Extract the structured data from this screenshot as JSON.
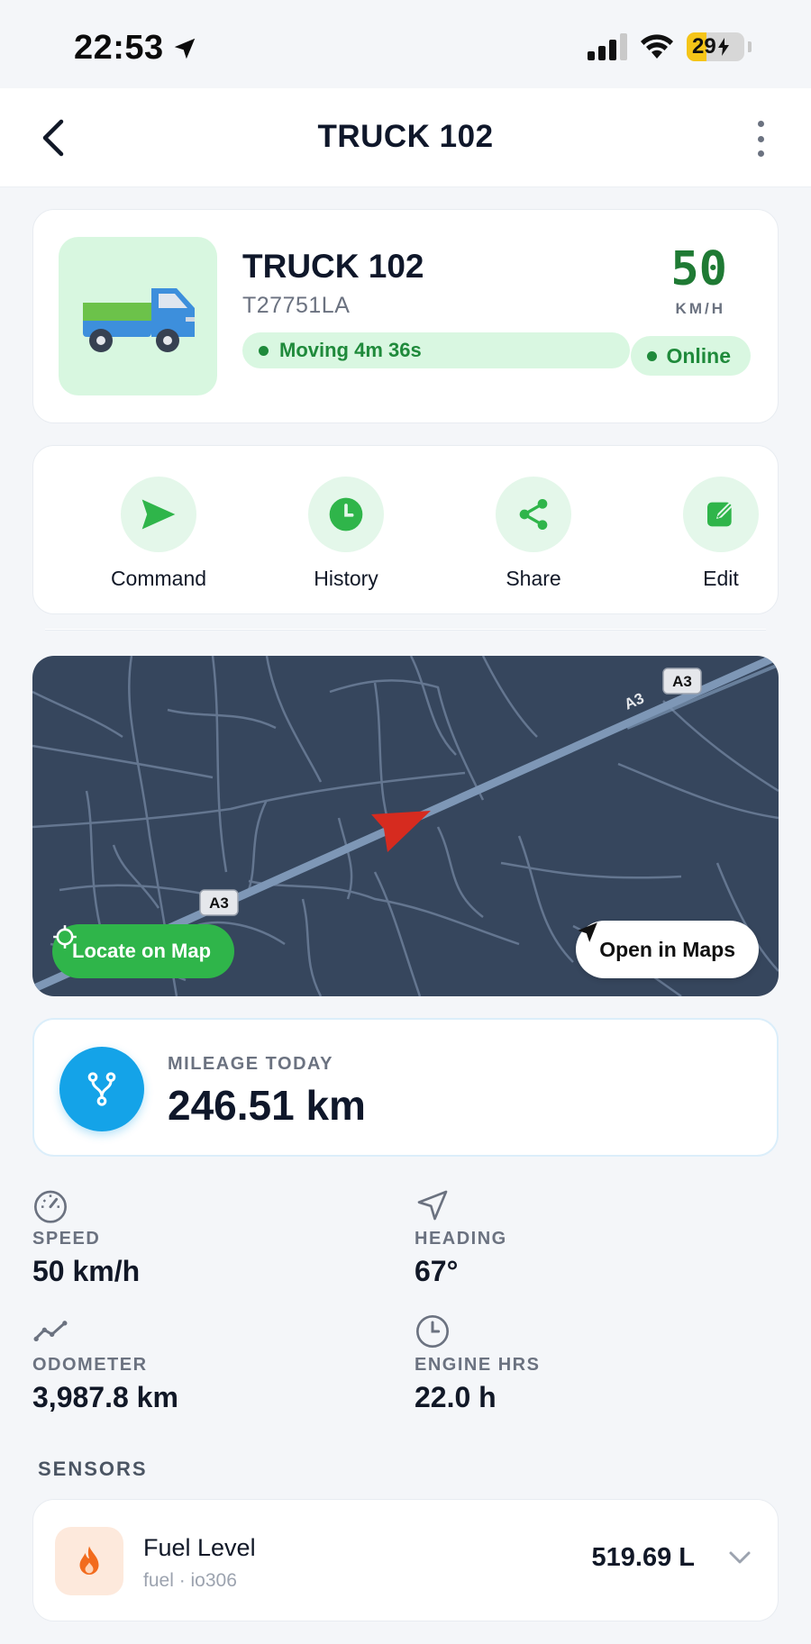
{
  "status_bar": {
    "time": "22:53",
    "battery": "29"
  },
  "header": {
    "title": "TRUCK 102"
  },
  "vehicle": {
    "name": "TRUCK 102",
    "plate": "T27751LA",
    "motion_status": "Moving 4m 36s",
    "speed": "50",
    "speed_unit": "KM/H",
    "connection": "Online"
  },
  "actions": [
    {
      "label": "Command",
      "icon": "send-icon"
    },
    {
      "label": "History",
      "icon": "clock-icon"
    },
    {
      "label": "Share",
      "icon": "share-icon"
    },
    {
      "label": "Edit",
      "icon": "edit-icon"
    }
  ],
  "map": {
    "road_label": "A3",
    "locate_label": "Locate on Map",
    "open_maps_label": "Open in Maps"
  },
  "mileage": {
    "label": "MILEAGE TODAY",
    "value": "246.51 km"
  },
  "stats": {
    "speed": {
      "label": "SPEED",
      "value": "50 km/h"
    },
    "heading": {
      "label": "HEADING",
      "value": "67°"
    },
    "odometer": {
      "label": "ODOMETER",
      "value": "3,987.8 km"
    },
    "engine": {
      "label": "ENGINE HRS",
      "value": "22.0 h"
    }
  },
  "sensors": {
    "title": "SENSORS",
    "items": [
      {
        "name": "Fuel Level",
        "sub": "fuel · io306",
        "value": "519.69 L"
      }
    ]
  },
  "colors": {
    "accent": "#2fb54a",
    "map_bg": "#36465d",
    "mileage_blue": "#14a3e8",
    "arrow": "#d62b1f"
  }
}
